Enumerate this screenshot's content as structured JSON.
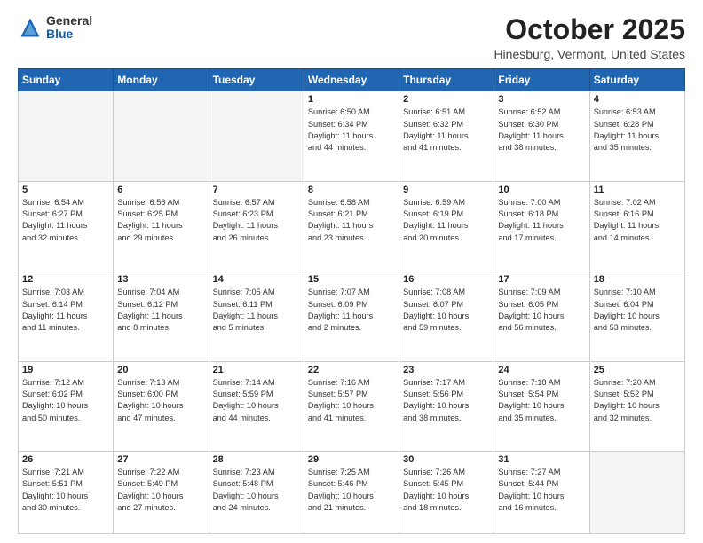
{
  "header": {
    "logo_general": "General",
    "logo_blue": "Blue",
    "month_title": "October 2025",
    "location": "Hinesburg, Vermont, United States"
  },
  "weekdays": [
    "Sunday",
    "Monday",
    "Tuesday",
    "Wednesday",
    "Thursday",
    "Friday",
    "Saturday"
  ],
  "weeks": [
    [
      {
        "day": "",
        "info": ""
      },
      {
        "day": "",
        "info": ""
      },
      {
        "day": "",
        "info": ""
      },
      {
        "day": "1",
        "info": "Sunrise: 6:50 AM\nSunset: 6:34 PM\nDaylight: 11 hours\nand 44 minutes."
      },
      {
        "day": "2",
        "info": "Sunrise: 6:51 AM\nSunset: 6:32 PM\nDaylight: 11 hours\nand 41 minutes."
      },
      {
        "day": "3",
        "info": "Sunrise: 6:52 AM\nSunset: 6:30 PM\nDaylight: 11 hours\nand 38 minutes."
      },
      {
        "day": "4",
        "info": "Sunrise: 6:53 AM\nSunset: 6:28 PM\nDaylight: 11 hours\nand 35 minutes."
      }
    ],
    [
      {
        "day": "5",
        "info": "Sunrise: 6:54 AM\nSunset: 6:27 PM\nDaylight: 11 hours\nand 32 minutes."
      },
      {
        "day": "6",
        "info": "Sunrise: 6:56 AM\nSunset: 6:25 PM\nDaylight: 11 hours\nand 29 minutes."
      },
      {
        "day": "7",
        "info": "Sunrise: 6:57 AM\nSunset: 6:23 PM\nDaylight: 11 hours\nand 26 minutes."
      },
      {
        "day": "8",
        "info": "Sunrise: 6:58 AM\nSunset: 6:21 PM\nDaylight: 11 hours\nand 23 minutes."
      },
      {
        "day": "9",
        "info": "Sunrise: 6:59 AM\nSunset: 6:19 PM\nDaylight: 11 hours\nand 20 minutes."
      },
      {
        "day": "10",
        "info": "Sunrise: 7:00 AM\nSunset: 6:18 PM\nDaylight: 11 hours\nand 17 minutes."
      },
      {
        "day": "11",
        "info": "Sunrise: 7:02 AM\nSunset: 6:16 PM\nDaylight: 11 hours\nand 14 minutes."
      }
    ],
    [
      {
        "day": "12",
        "info": "Sunrise: 7:03 AM\nSunset: 6:14 PM\nDaylight: 11 hours\nand 11 minutes."
      },
      {
        "day": "13",
        "info": "Sunrise: 7:04 AM\nSunset: 6:12 PM\nDaylight: 11 hours\nand 8 minutes."
      },
      {
        "day": "14",
        "info": "Sunrise: 7:05 AM\nSunset: 6:11 PM\nDaylight: 11 hours\nand 5 minutes."
      },
      {
        "day": "15",
        "info": "Sunrise: 7:07 AM\nSunset: 6:09 PM\nDaylight: 11 hours\nand 2 minutes."
      },
      {
        "day": "16",
        "info": "Sunrise: 7:08 AM\nSunset: 6:07 PM\nDaylight: 10 hours\nand 59 minutes."
      },
      {
        "day": "17",
        "info": "Sunrise: 7:09 AM\nSunset: 6:05 PM\nDaylight: 10 hours\nand 56 minutes."
      },
      {
        "day": "18",
        "info": "Sunrise: 7:10 AM\nSunset: 6:04 PM\nDaylight: 10 hours\nand 53 minutes."
      }
    ],
    [
      {
        "day": "19",
        "info": "Sunrise: 7:12 AM\nSunset: 6:02 PM\nDaylight: 10 hours\nand 50 minutes."
      },
      {
        "day": "20",
        "info": "Sunrise: 7:13 AM\nSunset: 6:00 PM\nDaylight: 10 hours\nand 47 minutes."
      },
      {
        "day": "21",
        "info": "Sunrise: 7:14 AM\nSunset: 5:59 PM\nDaylight: 10 hours\nand 44 minutes."
      },
      {
        "day": "22",
        "info": "Sunrise: 7:16 AM\nSunset: 5:57 PM\nDaylight: 10 hours\nand 41 minutes."
      },
      {
        "day": "23",
        "info": "Sunrise: 7:17 AM\nSunset: 5:56 PM\nDaylight: 10 hours\nand 38 minutes."
      },
      {
        "day": "24",
        "info": "Sunrise: 7:18 AM\nSunset: 5:54 PM\nDaylight: 10 hours\nand 35 minutes."
      },
      {
        "day": "25",
        "info": "Sunrise: 7:20 AM\nSunset: 5:52 PM\nDaylight: 10 hours\nand 32 minutes."
      }
    ],
    [
      {
        "day": "26",
        "info": "Sunrise: 7:21 AM\nSunset: 5:51 PM\nDaylight: 10 hours\nand 30 minutes."
      },
      {
        "day": "27",
        "info": "Sunrise: 7:22 AM\nSunset: 5:49 PM\nDaylight: 10 hours\nand 27 minutes."
      },
      {
        "day": "28",
        "info": "Sunrise: 7:23 AM\nSunset: 5:48 PM\nDaylight: 10 hours\nand 24 minutes."
      },
      {
        "day": "29",
        "info": "Sunrise: 7:25 AM\nSunset: 5:46 PM\nDaylight: 10 hours\nand 21 minutes."
      },
      {
        "day": "30",
        "info": "Sunrise: 7:26 AM\nSunset: 5:45 PM\nDaylight: 10 hours\nand 18 minutes."
      },
      {
        "day": "31",
        "info": "Sunrise: 7:27 AM\nSunset: 5:44 PM\nDaylight: 10 hours\nand 16 minutes."
      },
      {
        "day": "",
        "info": ""
      }
    ]
  ]
}
